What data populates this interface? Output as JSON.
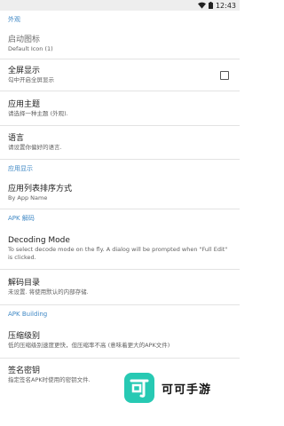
{
  "status_bar": {
    "time": "12:43",
    "icons": [
      "wifi-icon",
      "battery-icon"
    ]
  },
  "sections": {
    "appearance": "外观",
    "app_display": "应用显示",
    "apk_decode": "APK 解码",
    "apk_building": "APK Building"
  },
  "prefs": {
    "launch_icon": {
      "title": "启动图标",
      "summary": "Default Icon (1)"
    },
    "fullscreen": {
      "title": "全屏显示",
      "summary": "勾中开启全屏显示",
      "checked": false
    },
    "theme": {
      "title": "应用主题",
      "summary": "请选择一种主题 (外观)."
    },
    "language": {
      "title": "语言",
      "summary": "请设置你偏好的语言."
    },
    "sort_order": {
      "title": "应用列表排序方式",
      "summary": "By App Name"
    },
    "decoding_mode": {
      "title": "Decoding Mode",
      "summary": "To select decode mode on the fly. A dialog will be prompted when \"Full Edit\" is clicked."
    },
    "decode_dir": {
      "title": "解码目录",
      "summary": "未设置. 将使用默认的内部存储."
    },
    "compression": {
      "title": "压缩级别",
      "summary": "低的压缩级别速度更快，但压缩率不高 (意味着更大的APK文件)"
    },
    "signing_key": {
      "title": "签名密钥",
      "summary": "指定签名APK时使用的密钥文件."
    }
  },
  "watermark": {
    "text": "可可手游",
    "logo_char": "可"
  }
}
